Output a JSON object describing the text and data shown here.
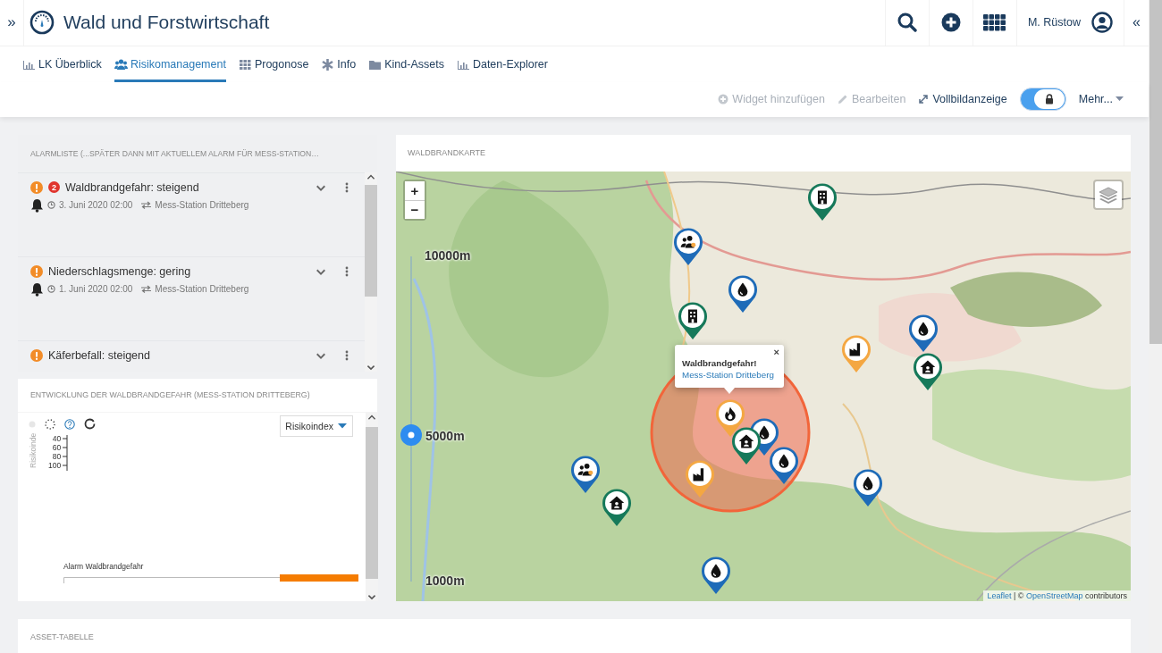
{
  "header": {
    "expand_symbol": "»",
    "title": "Wald und Forstwirtschaft",
    "user": "M. Rüstow",
    "collapse_symbol": "«"
  },
  "tabs": [
    {
      "label": "LK Überblick",
      "kind": "chart",
      "selected": false
    },
    {
      "label": "Risikomanagement",
      "kind": "users",
      "selected": true
    },
    {
      "label": "Progonose",
      "kind": "grid",
      "selected": false
    },
    {
      "label": "Info",
      "kind": "asterisk",
      "selected": false
    },
    {
      "label": "Kind-Assets",
      "kind": "folder",
      "selected": false
    },
    {
      "label": "Daten-Explorer",
      "kind": "chart",
      "selected": false
    }
  ],
  "toolbar": {
    "actions": [
      {
        "label": "Widget hinzufügen",
        "kind": "add",
        "disabled": true
      },
      {
        "label": "Bearbeiten",
        "kind": "edit",
        "disabled": true
      },
      {
        "label": "Vollbildanzeige",
        "kind": "fullscreen",
        "disabled": false
      }
    ],
    "lock_toggle": {
      "on": true
    },
    "more": "Mehr..."
  },
  "alarm_list": {
    "title": "ALARMLISTE (...SPÄTER DANN MIT AKTUELLEM ALARM FÜR MESS-STATION…",
    "items": [
      {
        "title": "Waldbrandgefahr: steigend",
        "count": "2",
        "date": "3. Juni 2020 02:00",
        "station": "Mess-Station Dritteberg"
      },
      {
        "title": "Niederschlagsmenge: gering",
        "date": "1. Juni 2020 02:00",
        "station": "Mess-Station Dritteberg"
      },
      {
        "title": "Käferbefall: steigend"
      }
    ]
  },
  "chart_panel": {
    "title": "ENTWICKLUNG DER WALDBRANDGEFAHR (MESS-STATION DRITTEBERG)",
    "dropdown": "Risikoindex",
    "ylabel": "Risikoinde",
    "yticks": [
      "40",
      "60",
      "80",
      "100"
    ],
    "track_label": "Alarm Waldbrandgefahr"
  },
  "map": {
    "title": "WALDBRANDKARTE",
    "zoom": [
      "+",
      "−"
    ],
    "altitude": {
      "labels": [
        "10000m",
        "5000m",
        "1000m"
      ],
      "level": 0.45
    },
    "popup": {
      "title": "Waldbrandgefahr!",
      "link": "Mess-Station Dritteberg",
      "close": "×"
    },
    "markers": [
      {
        "kind": "building",
        "color": "#16795a"
      },
      {
        "kind": "people",
        "color": "#1e6bb8"
      },
      {
        "kind": "water",
        "color": "#1e6bb8"
      },
      {
        "kind": "building",
        "color": "#16795a"
      },
      {
        "kind": "factory",
        "color": "#f4a742"
      },
      {
        "kind": "water",
        "color": "#1e6bb8"
      },
      {
        "kind": "house",
        "color": "#16795a"
      },
      {
        "kind": "fire",
        "color": "#f4a742"
      },
      {
        "kind": "water",
        "color": "#1e6bb8"
      },
      {
        "kind": "house",
        "color": "#16795a"
      },
      {
        "kind": "water",
        "color": "#1e6bb8"
      },
      {
        "kind": "factory",
        "color": "#f4a742"
      },
      {
        "kind": "people",
        "color": "#1e6bb8"
      },
      {
        "kind": "house",
        "color": "#16795a"
      },
      {
        "kind": "water",
        "color": "#1e6bb8"
      },
      {
        "kind": "water",
        "color": "#1e6bb8"
      }
    ],
    "attribution": {
      "leaflet": "Leaflet",
      "middle": "| ©",
      "osm": "OpenStreetMap",
      "tail": "contributors"
    }
  },
  "asset_table": {
    "title": "ASSET-TABELLE"
  }
}
